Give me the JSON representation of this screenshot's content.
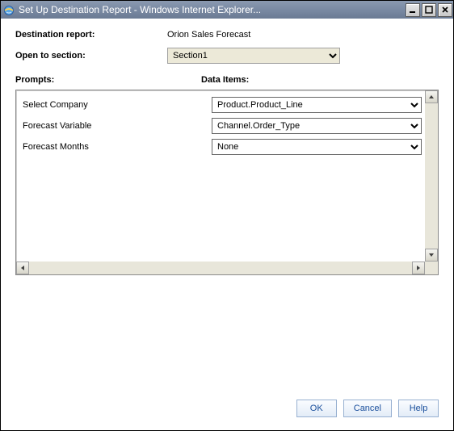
{
  "window": {
    "title": "Set Up Destination Report - Windows Internet Explorer..."
  },
  "form": {
    "destination_report_label": "Destination report:",
    "destination_report_value": "Orion Sales Forecast",
    "open_to_section_label": "Open to section:",
    "open_to_section_value": "Section1",
    "prompts_header": "Prompts:",
    "data_items_header": "Data Items:",
    "rows": [
      {
        "label": "Select Company",
        "value": "Product.Product_Line"
      },
      {
        "label": "Forecast Variable",
        "value": "Channel.Order_Type"
      },
      {
        "label": "Forecast Months",
        "value": "None"
      }
    ]
  },
  "buttons": {
    "ok": "OK",
    "cancel": "Cancel",
    "help": "Help"
  }
}
